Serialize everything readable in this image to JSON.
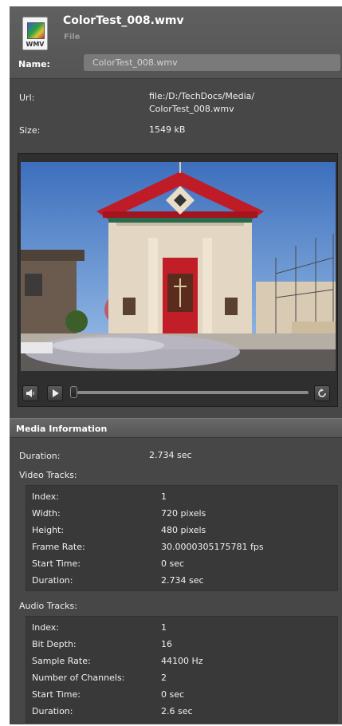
{
  "header": {
    "icon": "wmv-file-icon",
    "icon_ext": "WMV",
    "title": "ColorTest_008.wmv",
    "subtitle": "File"
  },
  "name_field": {
    "label": "Name:",
    "value": "ColorTest_008.wmv"
  },
  "properties": {
    "url_label": "Url:",
    "url_line1": "file:/D:/TechDocs/Media/",
    "url_line2": "ColorTest_008.wmv",
    "size_label": "Size:",
    "size_value": "1549 kB"
  },
  "player": {
    "buttons": [
      "volume-icon",
      "play-icon",
      "loop-icon"
    ],
    "seek_position": 0
  },
  "media_info": {
    "title": "Media Information",
    "duration_label": "Duration:",
    "duration_value": "2.734 sec",
    "video_tracks_label": "Video Tracks:",
    "video": [
      {
        "key": "Index:",
        "value": "1"
      },
      {
        "key": "Width:",
        "value": "720 pixels"
      },
      {
        "key": "Height:",
        "value": "480 pixels"
      },
      {
        "key": "Frame Rate:",
        "value": "30.0000305175781 fps"
      },
      {
        "key": "Start Time:",
        "value": "0 sec"
      },
      {
        "key": "Duration:",
        "value": "2.734 sec"
      }
    ],
    "audio_tracks_label": "Audio Tracks:",
    "audio": [
      {
        "key": "Index:",
        "value": "1"
      },
      {
        "key": "Bit Depth:",
        "value": "16"
      },
      {
        "key": "Sample Rate:",
        "value": "44100 Hz"
      },
      {
        "key": "Number of Channels:",
        "value": "2"
      },
      {
        "key": "Start Time:",
        "value": "0 sec"
      },
      {
        "key": "Duration:",
        "value": "2.6 sec"
      }
    ]
  },
  "colors": {
    "panel_bg": "#474747",
    "header_bg": "#5a5a5a",
    "group_bg": "#393939",
    "text": "#f0f0f0"
  }
}
